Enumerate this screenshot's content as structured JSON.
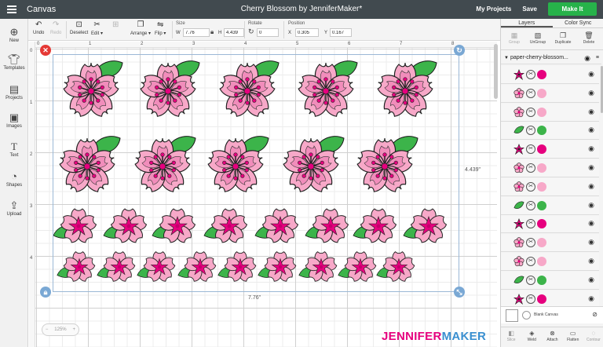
{
  "topbar": {
    "menu_icon": "hamburger-icon",
    "app_title": "Canvas",
    "project_title": "Cherry Blossom by JenniferMaker*",
    "my_projects": "My Projects",
    "save": "Save",
    "make_it": "Make It",
    "make_it_color": "#27b24a"
  },
  "toolbar": {
    "undo": "Undo",
    "redo": "Redo",
    "deselect": "Deselect",
    "edit": "Edit",
    "arrange": "Arrange",
    "flip": "Flip",
    "size_label": "Size",
    "w_letter": "W",
    "w_value": "7.76",
    "h_letter": "H",
    "h_value": "4.439",
    "rotate_label": "Rotate",
    "rotate_value": "0",
    "position_label": "Position",
    "x_letter": "X",
    "x_value": "0.305",
    "y_letter": "Y",
    "y_value": "0.167"
  },
  "sidebar": {
    "items": [
      {
        "label": "New",
        "icon": "plus-icon"
      },
      {
        "label": "Templates",
        "icon": "shirt-icon"
      },
      {
        "label": "Projects",
        "icon": "projects-icon"
      },
      {
        "label": "Images",
        "icon": "images-icon"
      },
      {
        "label": "Text",
        "icon": "text-icon"
      },
      {
        "label": "Shapes",
        "icon": "shapes-icon"
      },
      {
        "label": "Upload",
        "icon": "upload-icon"
      }
    ]
  },
  "canvas": {
    "ruler_top": [
      "0",
      "1",
      "2",
      "3",
      "4",
      "5",
      "6",
      "7",
      "8"
    ],
    "ruler_left": [
      "0",
      "1",
      "2",
      "3",
      "4"
    ],
    "width_label": "7.76\"",
    "height_label": "4.439\"",
    "zoom_value": "125%",
    "colors": {
      "petal": "#f7a8c8",
      "center": "#e6007e",
      "leaf": "#3cb44a",
      "outline": "#222222"
    }
  },
  "layers_panel": {
    "tabs": [
      "Layers",
      "Color Sync"
    ],
    "actions": [
      "Group",
      "UnGroup",
      "Duplicate",
      "Delete"
    ],
    "group_name": "paper-cherry-blossom...",
    "rows": [
      {
        "shape": "star",
        "color": "#e6007e"
      },
      {
        "shape": "flower",
        "color": "#f7a8c8"
      },
      {
        "shape": "flower",
        "color": "#f7a8c8"
      },
      {
        "shape": "leaf",
        "color": "#3cb44a"
      },
      {
        "shape": "star",
        "color": "#e6007e"
      },
      {
        "shape": "flower",
        "color": "#f7a8c8"
      },
      {
        "shape": "flower",
        "color": "#f7a8c8"
      },
      {
        "shape": "leaf",
        "color": "#3cb44a"
      },
      {
        "shape": "star",
        "color": "#e6007e"
      },
      {
        "shape": "flower",
        "color": "#f7a8c8"
      },
      {
        "shape": "flower",
        "color": "#f7a8c8"
      },
      {
        "shape": "leaf",
        "color": "#3cb44a"
      },
      {
        "shape": "star",
        "color": "#e6007e"
      }
    ],
    "blank_canvas": "Blank Canvas",
    "bottom_actions": [
      "Slice",
      "Weld",
      "Attach",
      "Flatten",
      "Contour"
    ]
  },
  "watermark": {
    "part1": "JENNIFER",
    "part2": "MAKER",
    "color1": "#e6007e",
    "color2": "#3a8fd0"
  }
}
